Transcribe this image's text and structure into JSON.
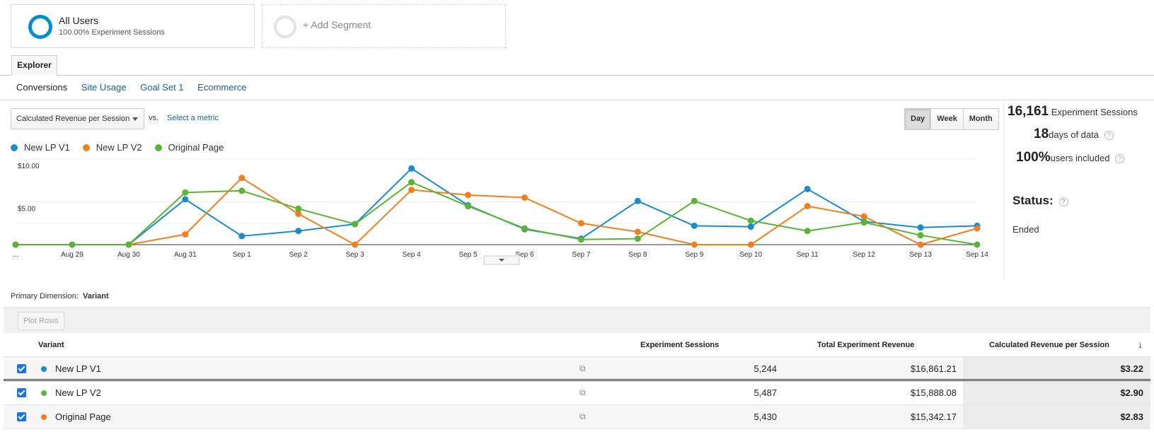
{
  "segments": {
    "main": {
      "title": "All Users",
      "subtitle": "100.00% Experiment Sessions"
    },
    "add_label": "+ Add Segment"
  },
  "tabs": {
    "explorer": "Explorer"
  },
  "subtabs": {
    "conversions": "Conversions",
    "site_usage": "Site Usage",
    "goal_set": "Goal Set 1",
    "ecommerce": "Ecommerce"
  },
  "metric": {
    "selected": "Calculated Revenue per Session",
    "vs": "vs.",
    "select_metric": "Select a metric"
  },
  "period": {
    "day": "Day",
    "week": "Week",
    "month": "Month",
    "active": "Day"
  },
  "legend": [
    {
      "name": "New LP V1",
      "color": "#1b8bc9"
    },
    {
      "name": "New LP V2",
      "color": "#ef7f21"
    },
    {
      "name": "Original Page",
      "color": "#5cb335"
    }
  ],
  "stats": {
    "sessions_value": "16,161",
    "sessions_label": "Experiment Sessions",
    "days_value": "18",
    "days_label": "days of data",
    "users_value": "100%",
    "users_label": "users included",
    "status_label": "Status:",
    "status_value": "Ended",
    "help": "?"
  },
  "chart_data": {
    "type": "line",
    "x": [
      "...",
      "Aug 29",
      "Aug 30",
      "Aug 31",
      "Sep 1",
      "Sep 2",
      "Sep 3",
      "Sep 4",
      "Sep 5",
      "Sep 6",
      "Sep 7",
      "Sep 8",
      "Sep 9",
      "Sep 10",
      "Sep 11",
      "Sep 12",
      "Sep 13",
      "Sep 14"
    ],
    "y_ticks": [
      {
        "value": 10,
        "label": "$10.00"
      },
      {
        "value": 5,
        "label": "$5.00"
      }
    ],
    "ylim": [
      0,
      10
    ],
    "series": [
      {
        "name": "New LP V1",
        "color": "#1b8bc9",
        "values": [
          0,
          0,
          0,
          5.3,
          1.0,
          1.6,
          2.4,
          8.9,
          4.6,
          1.8,
          0.7,
          5.1,
          2.2,
          2.1,
          6.5,
          2.7,
          2.0,
          2.2
        ]
      },
      {
        "name": "New LP V2",
        "color": "#ef7f21",
        "values": [
          0,
          0,
          0,
          1.2,
          7.8,
          3.6,
          0,
          6.4,
          5.8,
          5.5,
          2.5,
          1.5,
          0,
          0,
          4.5,
          3.3,
          0,
          1.9
        ]
      },
      {
        "name": "Original Page",
        "color": "#5cb335",
        "values": [
          0,
          0,
          0,
          6.1,
          6.3,
          4.2,
          2.4,
          7.3,
          4.5,
          1.9,
          0.6,
          0.7,
          5.1,
          2.8,
          1.6,
          2.6,
          1.1,
          0
        ]
      }
    ],
    "grid": true
  },
  "table": {
    "primary_dimension_label": "Primary Dimension:",
    "primary_dimension_value": "Variant",
    "plot_rows": "Plot Rows",
    "headers": {
      "variant": "Variant",
      "sessions": "Experiment Sessions",
      "revenue": "Total Experiment Revenue",
      "rps": "Calculated Revenue per Session"
    },
    "sort_icon": "arrow-down-icon",
    "rows": [
      {
        "variant": "New LP V1",
        "color": "#1b8bc9",
        "sessions": "5,244",
        "revenue": "$16,861.21",
        "rps": "$3.22"
      },
      {
        "variant": "New LP V2",
        "color": "#5cb335",
        "sessions": "5,487",
        "revenue": "$15,888.08",
        "rps": "$2.90"
      },
      {
        "variant": "Original Page",
        "color": "#ef7f21",
        "sessions": "5,430",
        "revenue": "$15,342.17",
        "rps": "$2.83"
      }
    ]
  }
}
